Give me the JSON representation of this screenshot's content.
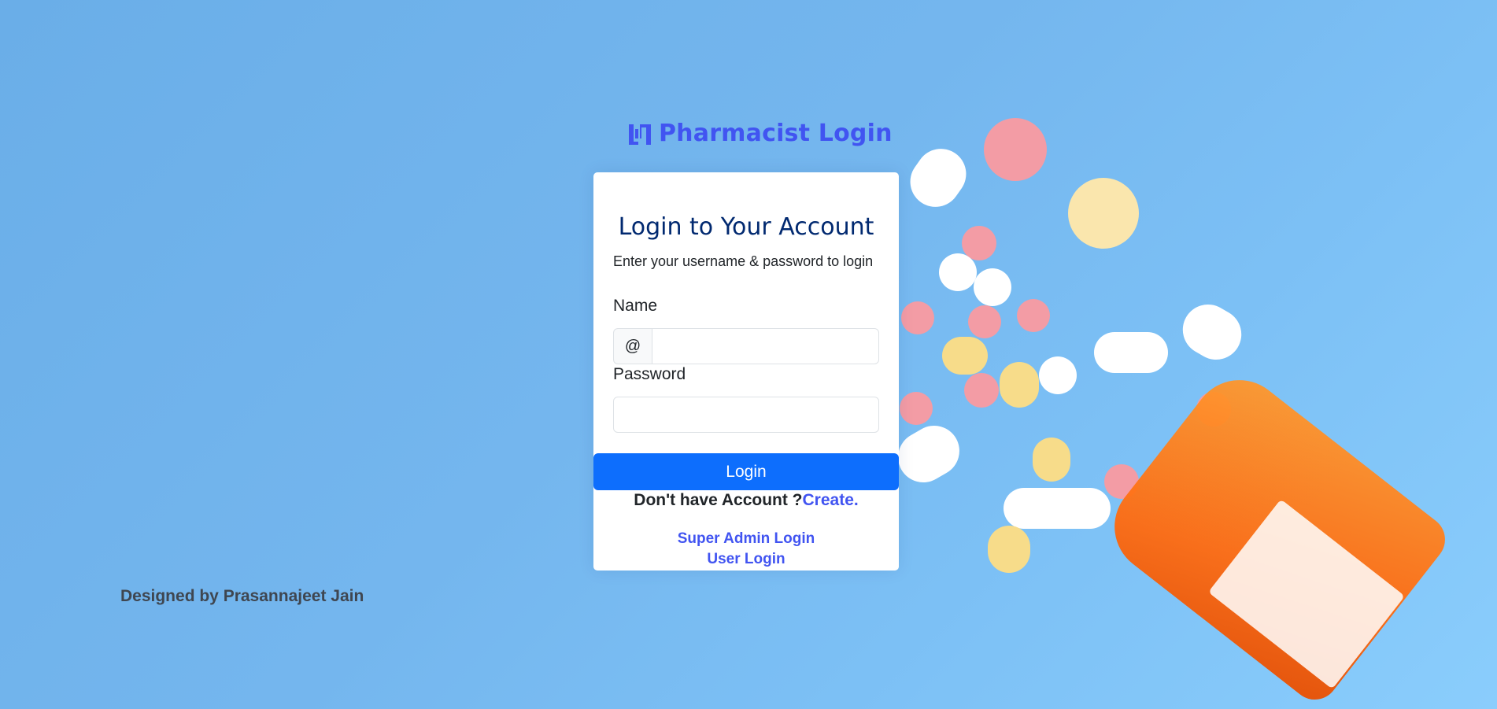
{
  "brand": {
    "title": "Pharmacist Login",
    "logo_icon": "logo-icon"
  },
  "card": {
    "title": "Login to Your Account",
    "subtitle": "Enter your username & password to login",
    "name_label": "Name",
    "name_prefix": "@",
    "name_value": "",
    "password_label": "Password",
    "password_value": "",
    "login_button": "Login",
    "signup_prompt": "Don't have Account ?",
    "signup_link": "Create.",
    "super_admin_link": "Super Admin Login",
    "user_login_link": "User Login"
  },
  "footer": {
    "credit": "Designed by Prasannajeet Jain"
  },
  "colors": {
    "brand": "#4154f1",
    "primary_button": "#0d6efd",
    "title": "#012970",
    "background": "#74b6ee"
  }
}
